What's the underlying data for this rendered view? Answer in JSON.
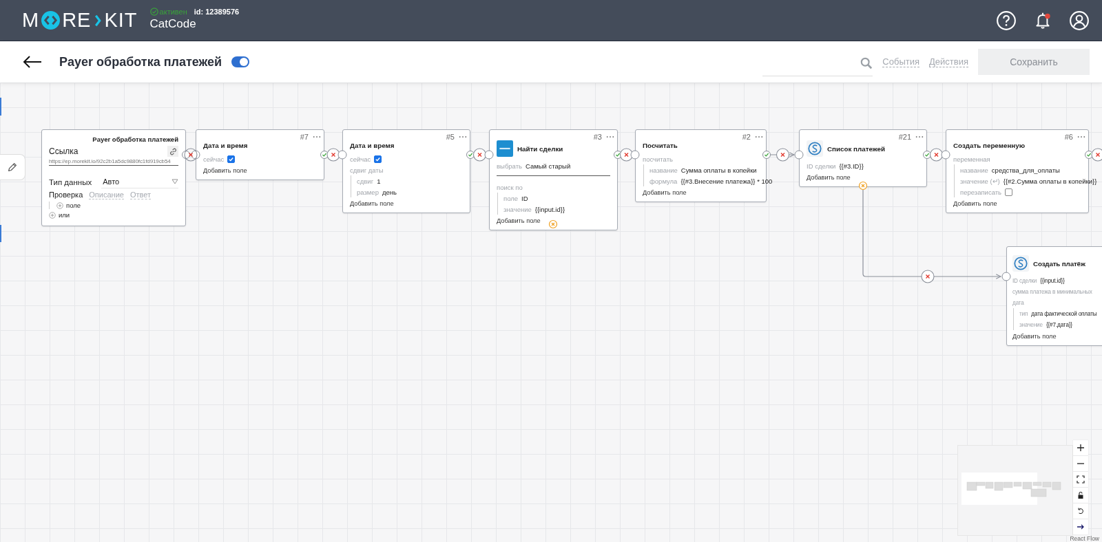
{
  "header": {
    "logo": [
      "M",
      "RE",
      "KIT"
    ],
    "status": "активен",
    "id": "id: 12389576",
    "workspace": "CatCode",
    "notification": true
  },
  "toolbar": {
    "title": "Payer обработка платежей",
    "enabled": true,
    "tabs": [
      {
        "label": "События",
        "selected": false
      },
      {
        "label": "Действия",
        "selected": false
      }
    ],
    "save": "Сохранить"
  },
  "start": {
    "title": "Payer обработка платежей",
    "link_label": "Ссылка",
    "url": "https://ep.morekit.io/92c2b1a5dc9880fc1fd919cb54",
    "type_label": "Тип данных",
    "type_value": "Авто",
    "tabs": [
      {
        "label": "Проверка",
        "selected": true
      },
      {
        "label": "Описание",
        "selected": false
      },
      {
        "label": "Ответ",
        "selected": false
      }
    ],
    "conditions": [
      {
        "kind": "field",
        "label": "поле"
      },
      {
        "kind": "or",
        "label": "или"
      }
    ]
  },
  "nodes": [
    {
      "kind": "plain",
      "number": "#7",
      "title": "Дата и время",
      "rows": [
        {
          "kind": "check",
          "label": "сейчас",
          "checked": true
        },
        {
          "kind": "add",
          "label": "Добавить поле"
        }
      ]
    },
    {
      "kind": "plain",
      "number": "#5",
      "title": "Дата и время",
      "rows": [
        {
          "kind": "check",
          "label": "сейчас",
          "checked": true
        },
        {
          "kind": "group",
          "label": "сдвиг даты",
          "children": [
            {
              "kind": "field",
              "label": "сдвиг",
              "value": "1"
            },
            {
              "kind": "field",
              "label": "размер",
              "value": "день"
            }
          ]
        },
        {
          "kind": "add",
          "label": "Добавить поле"
        }
      ]
    },
    {
      "kind": "crm",
      "number": "#3",
      "title": "Найти сделки",
      "rows": [
        {
          "kind": "field",
          "label": "выбрать",
          "value": "Самый старый"
        },
        {
          "kind": "divider"
        },
        {
          "kind": "group",
          "label": "поиск по",
          "children": [
            {
              "kind": "field",
              "label": "поле",
              "value": "ID"
            },
            {
              "kind": "field",
              "label": "значение",
              "value": "{{input.id}}"
            }
          ]
        },
        {
          "kind": "add",
          "label": "Добавить поле"
        }
      ]
    },
    {
      "kind": "plain",
      "number": "#2",
      "title": "Посчитать",
      "rows": [
        {
          "kind": "group",
          "label": "посчитать",
          "children": [
            {
              "kind": "field",
              "label": "название",
              "value": "Сумма оплаты в копейки"
            },
            {
              "kind": "field",
              "label": "формула",
              "value": "{{#3.Внесение платежа}} * 100"
            }
          ]
        },
        {
          "kind": "add",
          "label": "Добавить поле"
        }
      ]
    },
    {
      "kind": "payment",
      "number": "#21",
      "title": "Список платежей",
      "rows": [
        {
          "kind": "field",
          "label": "ID сделки",
          "value": "{{#3.ID}}"
        },
        {
          "kind": "add",
          "label": "Добавить поле"
        }
      ]
    },
    {
      "kind": "plain",
      "number": "#6",
      "title": "Создать переменную",
      "rows": [
        {
          "kind": "group",
          "label": "переменная",
          "children": [
            {
              "kind": "field",
              "label": "название",
              "value": "средства_для_оплаты"
            },
            {
              "kind": "field",
              "label": "значение (↵)",
              "value": "{{#2.Сумма оплаты в копейки}}"
            },
            {
              "kind": "check",
              "label": "перезаписать",
              "checked": false
            }
          ]
        },
        {
          "kind": "add",
          "label": "Добавить поле"
        }
      ]
    },
    {
      "kind": "payment",
      "title": "Создать платёж",
      "rows": [
        {
          "kind": "field",
          "label": "ID сделки",
          "value": "{{input.id}}"
        },
        {
          "kind": "text",
          "label": "сумма платежа в минимальных"
        },
        {
          "kind": "group",
          "label": "дата",
          "children": [
            {
              "kind": "field",
              "label": "тип",
              "value": "дата фактической оплаты"
            },
            {
              "kind": "field",
              "label": "значение",
              "value": "{{#7.дата}}"
            }
          ]
        },
        {
          "kind": "add",
          "label": "Добавить поле"
        }
      ]
    }
  ],
  "minimap": {
    "attribution": "React Flow"
  }
}
